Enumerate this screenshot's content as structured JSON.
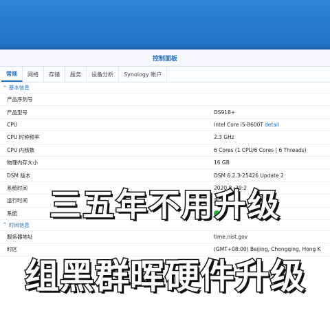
{
  "window": {
    "title": "控制面板"
  },
  "tabs": [
    {
      "label": "常规"
    },
    {
      "label": "网络"
    },
    {
      "label": "存储"
    },
    {
      "label": "服务"
    },
    {
      "label": "设备分析"
    },
    {
      "label": "Synology 帐户"
    }
  ],
  "basic": {
    "header": "基本信息",
    "rows": [
      {
        "label": "产品序列号",
        "value": ""
      },
      {
        "label": "产品型号",
        "value": "DS918+"
      },
      {
        "label": "CPU",
        "value": "Intel Core i5-8600T",
        "link": "detail"
      },
      {
        "label": "CPU 时钟频率",
        "value": "2.3 GHz"
      },
      {
        "label": "CPU 内核数",
        "value": "6 Cores (1 CPU/6 Cores | 6 Threads)"
      },
      {
        "label": "物理内存大小",
        "value": "16 GB"
      },
      {
        "label": "DSM 版本",
        "value": "DSM 6.2.3-25426 Update 2"
      },
      {
        "label": "系统时间",
        "value": "2020 8 :39:2"
      },
      {
        "label": "运行时间",
        "value": "天 38"
      },
      {
        "label": "系统",
        "value": ""
      }
    ]
  },
  "time": {
    "header": "时间信息",
    "rows": [
      {
        "label": "服务器地址",
        "value": "time.nist.gov"
      },
      {
        "label": "时区",
        "value": "(GMT+08:00) Beijing, Chongqing, Hong K"
      }
    ]
  },
  "overlay": {
    "line1": "三五年不用升级",
    "line2": "组黑群晖硬件升级"
  },
  "colors": {
    "accent": "#1f6fc4",
    "status_ok": "#27b13a"
  }
}
